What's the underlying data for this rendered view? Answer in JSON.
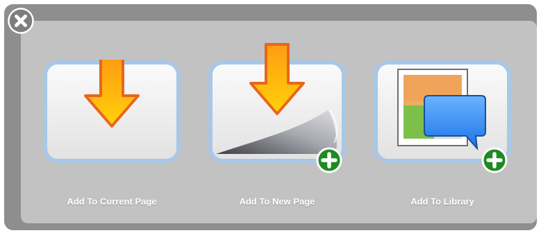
{
  "dialog": {
    "close_icon": "close-icon",
    "options": [
      {
        "label": "Add To Current Page",
        "icon": "download-arrow-icon"
      },
      {
        "label": "Add To New Page",
        "icon": "new-page-arrow-icon",
        "badge": "plus-badge-icon"
      },
      {
        "label": "Add To Library",
        "icon": "library-image-comment-icon",
        "badge": "plus-badge-icon"
      }
    ]
  },
  "colors": {
    "frame": "#8e8e8e",
    "panel": "#c2c2c2",
    "tile_border": "#a9c7e6",
    "arrow_fill": "#ffb515",
    "arrow_stroke": "#e8661c",
    "plus_badge": "#1e8a22",
    "comment_bubble": "#3b8ef5"
  }
}
